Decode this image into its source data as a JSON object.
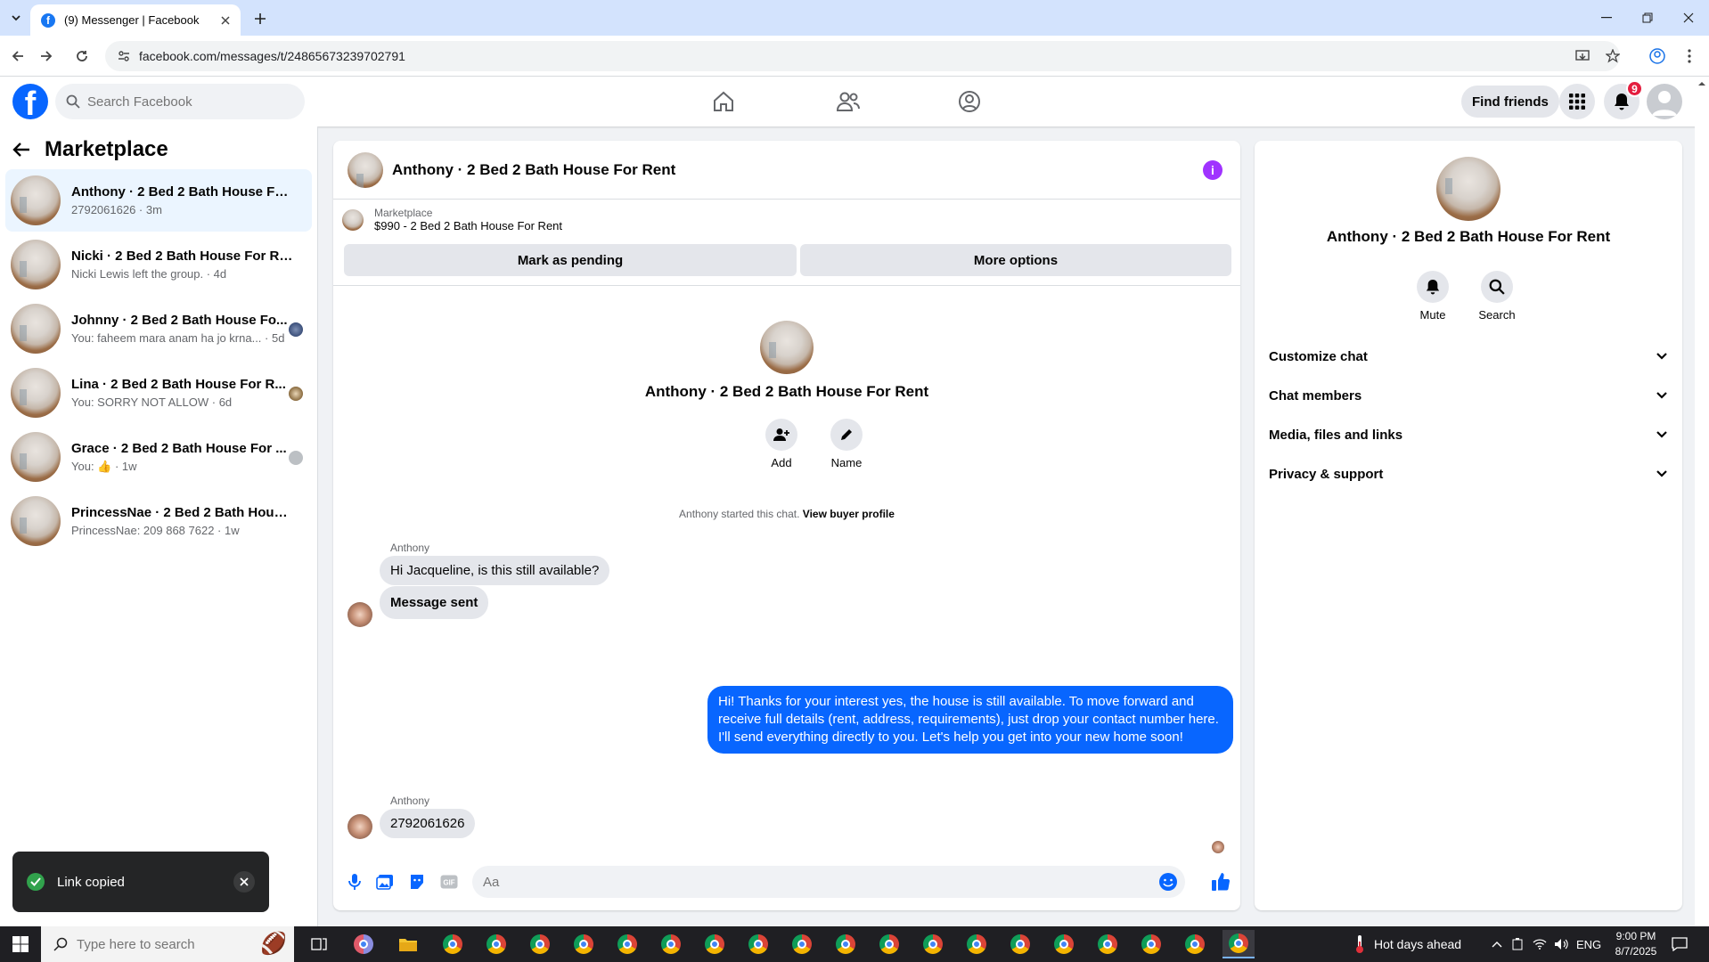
{
  "browser": {
    "tab_title": "(9) Messenger | Facebook",
    "url": "facebook.com/messages/t/24865673239702791"
  },
  "fb": {
    "search_placeholder": "Search Facebook",
    "find_friends": "Find friends",
    "notif_count": "9"
  },
  "left": {
    "title": "Marketplace",
    "conversations": [
      {
        "name": "Anthony · 2 Bed 2 Bath House For ...",
        "sub": "2792061626 · 3m"
      },
      {
        "name": "Nicki · 2 Bed 2 Bath House For Rent",
        "sub": "Nicki Lewis left the group. · 4d"
      },
      {
        "name": "Johnny · 2 Bed 2 Bath House Fo...",
        "sub": "You: faheem mara anam ha jo krna... · 5d"
      },
      {
        "name": "Lina · 2 Bed 2 Bath House For R...",
        "sub": "You: SORRY NOT ALLOW · 6d"
      },
      {
        "name": "Grace · 2 Bed 2 Bath House For ...",
        "sub": "You: 👍 · 1w"
      },
      {
        "name": "PrincessNae · 2 Bed 2 Bath House ...",
        "sub": "PrincessNae: 209 868 7622 · 1w"
      }
    ]
  },
  "chat": {
    "title": "Anthony · 2 Bed 2 Bath House For Rent",
    "marketplace_label": "Marketplace",
    "listing": "$990 - 2 Bed 2 Bath House For Rent",
    "mark_pending": "Mark as pending",
    "more_options": "More options",
    "intro_title": "Anthony · 2 Bed 2 Bath House For Rent",
    "add_label": "Add",
    "name_label": "Name",
    "started_text": "Anthony started this chat.",
    "view_buyer": "View buyer profile",
    "sender1": "Anthony",
    "msg1": "Hi Jacqueline, is this still available?",
    "msg2": "Message sent",
    "out_msg": "Hi! Thanks for your interest yes, the house is still available. To move forward and receive full details (rent, address, requirements), just drop your contact number here. I'll send everything directly to you. Let's help you get into your new home soon!",
    "sender2": "Anthony",
    "msg3": "2792061626",
    "composer_placeholder": "Aa"
  },
  "right": {
    "title": "Anthony · 2 Bed 2 Bath House For Rent",
    "mute": "Mute",
    "search": "Search",
    "sections": [
      "Customize chat",
      "Chat members",
      "Media, files and links",
      "Privacy & support"
    ]
  },
  "toast": {
    "text": "Link copied"
  },
  "taskbar": {
    "search_placeholder": "Type here to search",
    "weather": "Hot days ahead",
    "lang": "ENG",
    "time": "9:00 PM",
    "date": "8/7/2025"
  },
  "colors": {
    "brand": "#0866ff",
    "info": "#a033ff",
    "badge": "#e41e3f"
  }
}
